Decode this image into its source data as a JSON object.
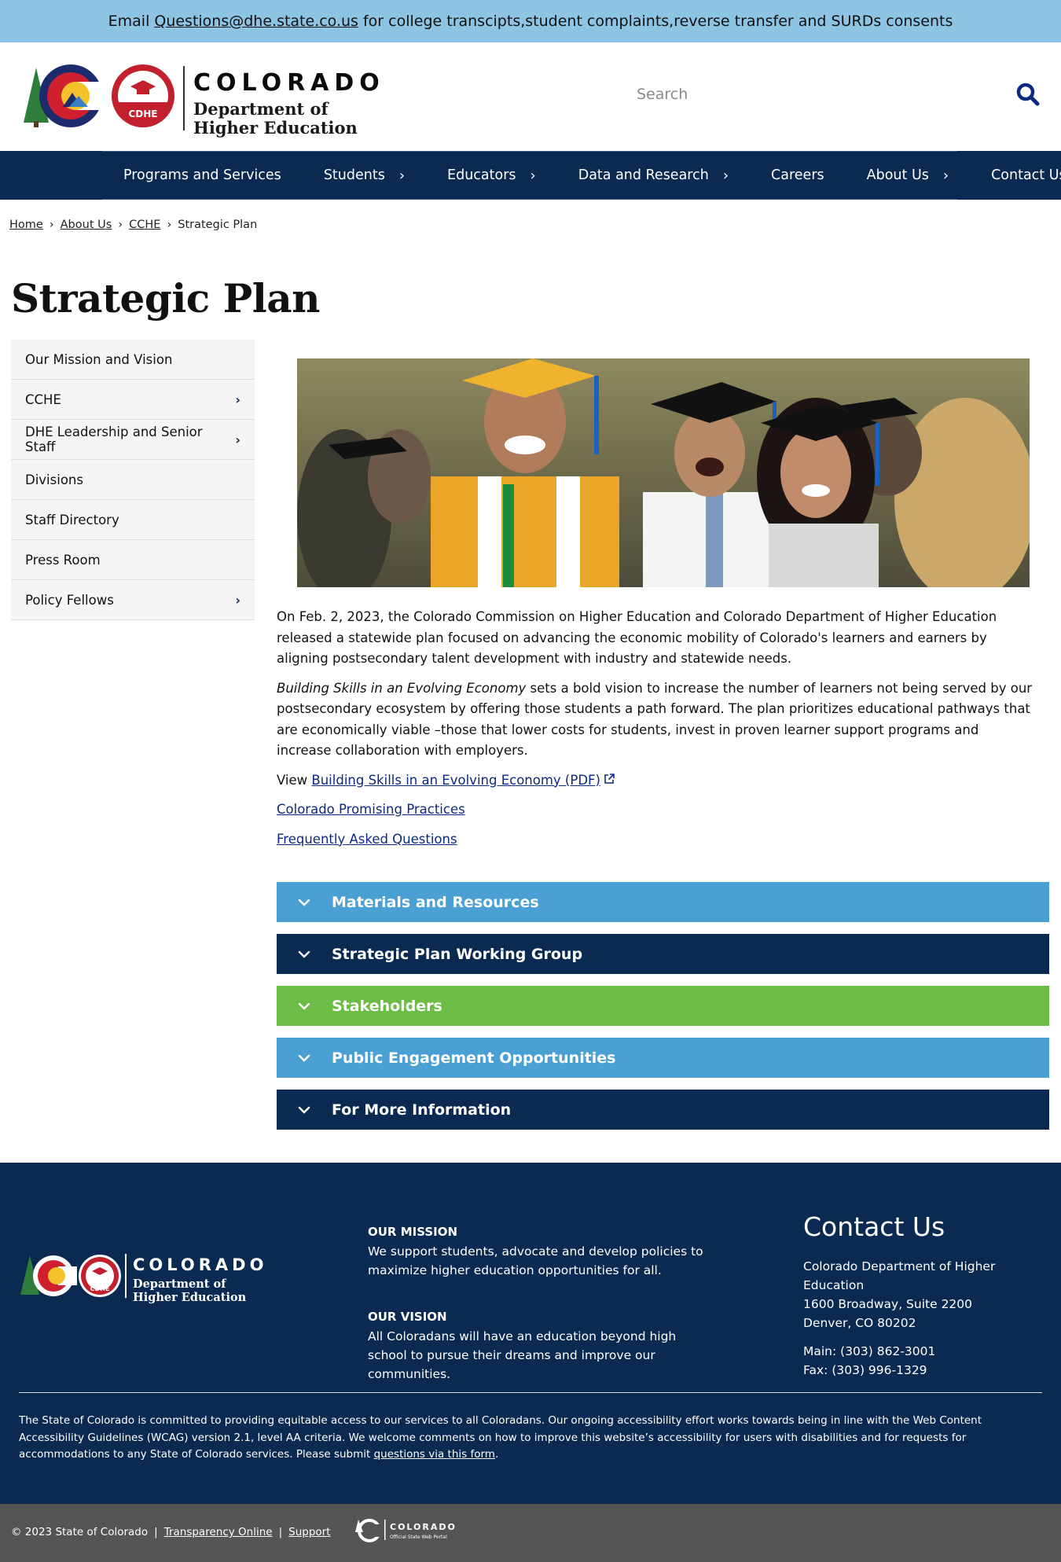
{
  "alert": {
    "prefix": "Email",
    "email": "Questions@dhe.state.co.us",
    "suffix": "for college transcipts,student complaints,reverse transfer and SURDs consents"
  },
  "header": {
    "logo_colorado": "COLORADO",
    "logo_badge": "CDHE",
    "logo_dept_line1": "Department of",
    "logo_dept_line2": "Higher Education",
    "search_placeholder": "Search"
  },
  "nav": {
    "items": [
      {
        "label": "Programs and Services",
        "has_submenu": false
      },
      {
        "label": "Students",
        "has_submenu": true
      },
      {
        "label": "Educators",
        "has_submenu": true
      },
      {
        "label": "Data and Research",
        "has_submenu": true
      },
      {
        "label": "Careers",
        "has_submenu": false
      },
      {
        "label": "About Us",
        "has_submenu": true
      },
      {
        "label": "Contact Us",
        "has_submenu": false
      }
    ]
  },
  "breadcrumb": {
    "items": [
      "Home",
      "About Us",
      "CCHE"
    ],
    "current": "Strategic Plan"
  },
  "page_title": "Strategic Plan",
  "sidebar": {
    "items": [
      {
        "label": "Our Mission and Vision",
        "has_submenu": false
      },
      {
        "label": "CCHE",
        "has_submenu": true
      },
      {
        "label": "DHE Leadership and Senior Staff",
        "has_submenu": true
      },
      {
        "label": "Divisions",
        "has_submenu": false
      },
      {
        "label": "Staff Directory",
        "has_submenu": false
      },
      {
        "label": "Press Room",
        "has_submenu": false
      },
      {
        "label": "Policy Fellows",
        "has_submenu": true
      }
    ]
  },
  "main": {
    "para1": "On Feb. 2, 2023, the Colorado Commission on Higher Education and Colorado Department of Higher Education released a statewide plan focused on advancing the economic mobility of Colorado's learners and earners by aligning postsecondary talent development with industry and statewide needs.",
    "para2_italic": "Building Skills in an Evolving Economy",
    "para2_rest": " sets a bold vision to increase the number of learners not being served by our postsecondary ecosystem by offering those students a path forward. The plan prioritizes educational pathways that are economically viable –those that lower costs for students, invest in proven learner support programs and increase collaboration with employers.",
    "view_prefix": "View ",
    "view_link": "Building Skills in an Evolving Economy (PDF)",
    "link_practices": "Colorado Promising Practices ",
    "link_faq": "Frequently Asked Questions "
  },
  "accordions": [
    {
      "label": "Materials and Resources",
      "color": "#4aa0d2"
    },
    {
      "label": "Strategic Plan Working Group",
      "color": "#0b2a52"
    },
    {
      "label": "Stakeholders",
      "color": "#6cbd45"
    },
    {
      "label": "Public Engagement Opportunities",
      "color": "#4aa0d2"
    },
    {
      "label": "For More Information",
      "color": "#0b2a52"
    }
  ],
  "footer": {
    "logo_colorado": "COLORADO",
    "logo_badge": "CDHE",
    "logo_dept_line1": "Department of",
    "logo_dept_line2": "Higher Education",
    "mission_heading": "OUR MISSION",
    "mission_text": "We support students, advocate and develop policies to maximize higher education opportunities for all.",
    "vision_heading": "OUR VISION",
    "vision_text": "All Coloradans will have an education beyond high school to pursue their dreams and improve our communities.",
    "contact_heading": "Contact Us",
    "contact_org": "Colorado Department of Higher Education",
    "contact_addr1": "1600 Broadway, Suite 2200",
    "contact_addr2": "Denver, CO 80202",
    "contact_main": "Main: (303) 862-3001",
    "contact_fax": "Fax: (303) 996-1329",
    "accessibility_text": "The State of Colorado is committed to providing equitable access to our services to all Coloradans. Our ongoing accessibility effort works towards being in line with the Web Content Accessibility Guidelines (WCAG) version 2.1, level AA criteria. We welcome comments on how to improve this website’s accessibility for users with disabilities and for requests for accommodations to any State of Colorado services. Please submit ",
    "accessibility_link": "questions via this form",
    "accessibility_end": "."
  },
  "bottom": {
    "copyright": "© 2023 State of Colorado",
    "sep": "|",
    "transparency": "Transparency Online",
    "support": "Support",
    "portal_name": "COLORADO",
    "portal_sub": "Official State Web Portal"
  },
  "colors": {
    "navy": "#0b2a52",
    "light_blue": "#4aa0d2",
    "green": "#6cbd45",
    "alert_bg": "#8ec4e3"
  }
}
